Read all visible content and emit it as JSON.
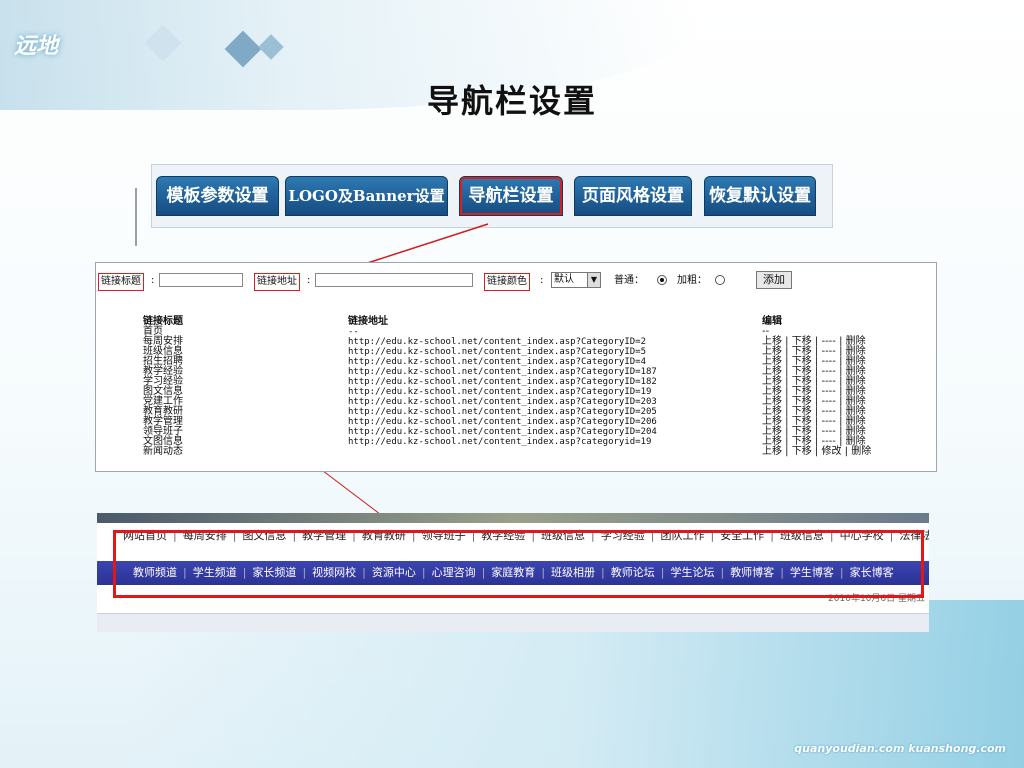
{
  "page_title": "导航栏设置",
  "logo_text": "远地",
  "tabs": [
    {
      "label": "模板参数设置"
    },
    {
      "label": "LOGO及Banner设置"
    },
    {
      "label": "导航栏设置"
    },
    {
      "label": "页面风格设置"
    },
    {
      "label": "恢复默认设置"
    }
  ],
  "form": {
    "title_label": "链接标题",
    "title_value": "",
    "url_label": "链接地址",
    "url_value": "",
    "color_label": "链接颜色",
    "color_colon": ":",
    "color_selected": "默认",
    "weight_normal": "普通：",
    "weight_bold": "加粗：",
    "add_button": "添加"
  },
  "list": {
    "col_title": "链接标题",
    "col_url": "链接地址",
    "col_edit": "编辑",
    "rows": [
      {
        "title": "首页",
        "url": "--",
        "up": "",
        "down": "",
        "modify": "",
        "del": "",
        "edit_text": "--"
      },
      {
        "title": "每周安排",
        "url": "http://edu.kz-school.net/content_index.asp?CategoryID=2",
        "up": "上移",
        "down": "下移",
        "modify": "----",
        "del": "删除"
      },
      {
        "title": "班级信息",
        "url": "http://edu.kz-school.net/content_index.asp?CategoryID=5",
        "up": "上移",
        "down": "下移",
        "modify": "----",
        "del": "删除"
      },
      {
        "title": "招生招聘",
        "url": "http://edu.kz-school.net/content_index.asp?CategoryID=4",
        "up": "上移",
        "down": "下移",
        "modify": "----",
        "del": "删除"
      },
      {
        "title": "教学经验",
        "url": "http://edu.kz-school.net/content_index.asp?CategoryID=187",
        "up": "上移",
        "down": "下移",
        "modify": "----",
        "del": "删除"
      },
      {
        "title": "学习经验",
        "url": "http://edu.kz-school.net/content_index.asp?CategoryID=182",
        "up": "上移",
        "down": "下移",
        "modify": "----",
        "del": "删除"
      },
      {
        "title": "图文信息",
        "url": "http://edu.kz-school.net/content_index.asp?CategoryID=19",
        "up": "上移",
        "down": "下移",
        "modify": "----",
        "del": "删除"
      },
      {
        "title": "党建工作",
        "url": "http://edu.kz-school.net/content_index.asp?CategoryID=203",
        "up": "上移",
        "down": "下移",
        "modify": "----",
        "del": "删除"
      },
      {
        "title": "教育教研",
        "url": "http://edu.kz-school.net/content_index.asp?CategoryID=205",
        "up": "上移",
        "down": "下移",
        "modify": "----",
        "del": "删除"
      },
      {
        "title": "教学管理",
        "url": "http://edu.kz-school.net/content_index.asp?CategoryID=206",
        "up": "上移",
        "down": "下移",
        "modify": "----",
        "del": "删除"
      },
      {
        "title": "领导班子",
        "url": "http://edu.kz-school.net/content_index.asp?CategoryID=204",
        "up": "上移",
        "down": "下移",
        "modify": "----",
        "del": "删除"
      },
      {
        "title": "文图信息",
        "url": "http://edu.kz-school.net/content_index.asp?categoryid=19",
        "up": "上移",
        "down": "下移",
        "modify": "----",
        "del": "删除"
      },
      {
        "title": "新闻动态",
        "url": "",
        "up": "上移",
        "down": "下移",
        "modify": "修改",
        "del": "删除"
      }
    ]
  },
  "site_nav_row1": [
    "网站首页",
    "每周安排",
    "图文信息",
    "教学管理",
    "教育教研",
    "领导班子",
    "教学经验",
    "班级信息",
    "学习经验",
    "团队工作",
    "安全工作",
    "班级信息",
    "中心学校",
    "法律法"
  ],
  "site_nav_row2": [
    "教师频道",
    "学生频道",
    "家长频道",
    "视频网校",
    "资源中心",
    "心理咨询",
    "家庭教育",
    "班级相册",
    "教师论坛",
    "学生论坛",
    "教师博客",
    "学生博客",
    "家长博客"
  ],
  "site_date": "2010年10月6日 星期五",
  "footer_url": "quanyoudian.com   kuanshong.com",
  "colors": {
    "tab_blue": "#1f5f98",
    "highlight_red": "#d92020",
    "nav_blue": "#2b3396"
  }
}
